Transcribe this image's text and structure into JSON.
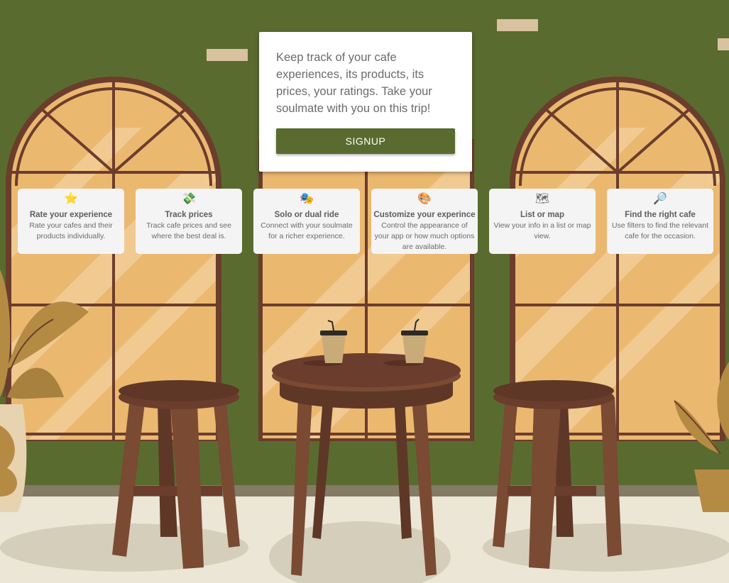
{
  "hero": {
    "text": "Keep track of your cafe experiences, its products, its prices, your ratings. Take your soulmate with you on this trip!",
    "signup_label": "SIGNUP"
  },
  "features": [
    {
      "icon": "star-icon",
      "glyph": "⭐",
      "title": "Rate your experience",
      "desc": "Rate your cafes and their products individually."
    },
    {
      "icon": "money-icon",
      "glyph": "💸",
      "title": "Track prices",
      "desc": "Track cafe prices and see where the best deal is."
    },
    {
      "icon": "masks-icon",
      "glyph": "🎭",
      "title": "Solo or dual ride",
      "desc": "Connect with your soulmate for a richer experience."
    },
    {
      "icon": "palette-icon",
      "glyph": "🎨",
      "title": "Customize your experince",
      "desc": "Control the appearance of your app or how much options are available."
    },
    {
      "icon": "world-map-icon",
      "glyph": "🗺",
      "title": "List or map",
      "desc": "View your info in a list or map view."
    },
    {
      "icon": "magnifier-icon",
      "glyph": "🔎",
      "title": "Find the right cafe",
      "desc": "Use filters to find the relevant cafe for the occasion."
    }
  ],
  "colors": {
    "wall": "#5a6b2f",
    "floor": "#ece6d7",
    "window_glass": "#ebb870",
    "window_frame": "#6b3d2c",
    "furniture": "#6b3d2c",
    "button": "#5a6b2f"
  }
}
